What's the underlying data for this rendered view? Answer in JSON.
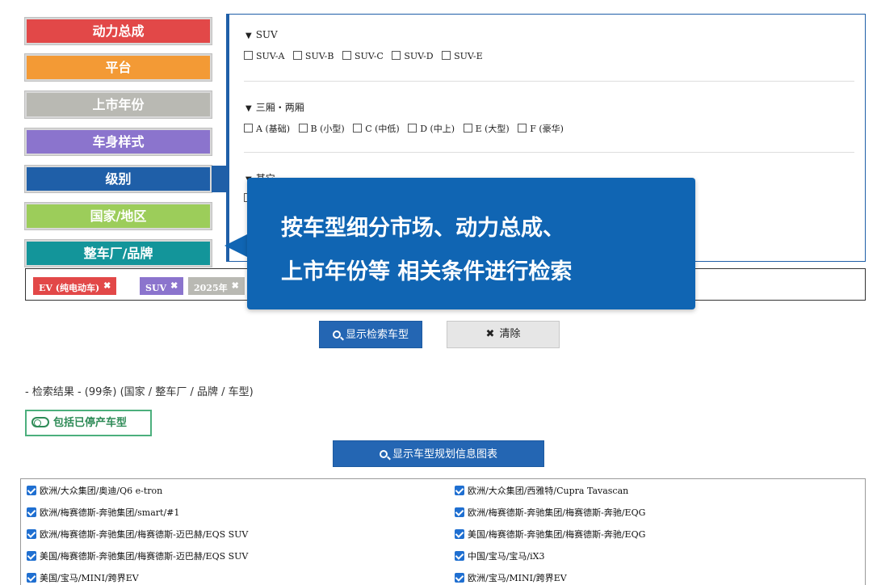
{
  "categories": [
    {
      "label": "动力总成",
      "color": "#e24848"
    },
    {
      "label": "平台",
      "color": "#f39a35"
    },
    {
      "label": "上市年份",
      "color": "#b9b9b3"
    },
    {
      "label": "车身样式",
      "color": "#8b74cd"
    },
    {
      "label": "级别",
      "color": "#1f5fa8"
    },
    {
      "label": "国家/地区",
      "color": "#9ccd5a"
    },
    {
      "label": "整车厂/品牌",
      "color": "#13959a"
    }
  ],
  "panel": {
    "groups": [
      {
        "title": "SUV",
        "options": [
          "SUV-A",
          "SUV-B",
          "SUV-C",
          "SUV-D",
          "SUV-E"
        ]
      },
      {
        "title": "三厢・两厢",
        "options": [
          "A (基础)",
          "B (小型)",
          "C (中低)",
          "D (中上)",
          "E (大型)",
          "F (豪华)"
        ]
      },
      {
        "title": "其它",
        "options": [
          ""
        ]
      }
    ]
  },
  "tags": [
    {
      "label": "EV (纯电动车)",
      "color": "#e24848"
    },
    {
      "label": "SUV",
      "color": "#8b74cd"
    },
    {
      "label": "2025年",
      "color": "#b9b9b3"
    }
  ],
  "tag_close_glyph": "✖",
  "tooltip": {
    "line1": "按车型细分市场、动力总成、",
    "line2": "上市年份等  相关条件进行检索"
  },
  "buttons": {
    "search": "显示检索车型",
    "clear": "清除",
    "chart": "显示车型规划信息图表",
    "include_discontinued": "包括已停产车型"
  },
  "results": {
    "title": "- 检索结果 - (99条) (国家 / 整车厂 / 品牌 / 车型)",
    "items_left": [
      "欧洲/大众集团/奥迪/Q6 e-tron",
      "欧洲/梅赛德斯-奔驰集团/smart/#1",
      "欧洲/梅赛德斯-奔驰集团/梅赛德斯-迈巴赫/EQS SUV",
      "美国/梅赛德斯-奔驰集团/梅赛德斯-迈巴赫/EQS SUV",
      "美国/宝马/MINI/跨界EV"
    ],
    "items_right": [
      "欧洲/大众集团/西雅特/Cupra Tavascan",
      "欧洲/梅赛德斯-奔驰集团/梅赛德斯-奔驰/EQG",
      "美国/梅赛德斯-奔驰集团/梅赛德斯-奔驰/EQG",
      "中国/宝马/宝马/iX3",
      "欧洲/宝马/MINI/跨界EV"
    ]
  }
}
